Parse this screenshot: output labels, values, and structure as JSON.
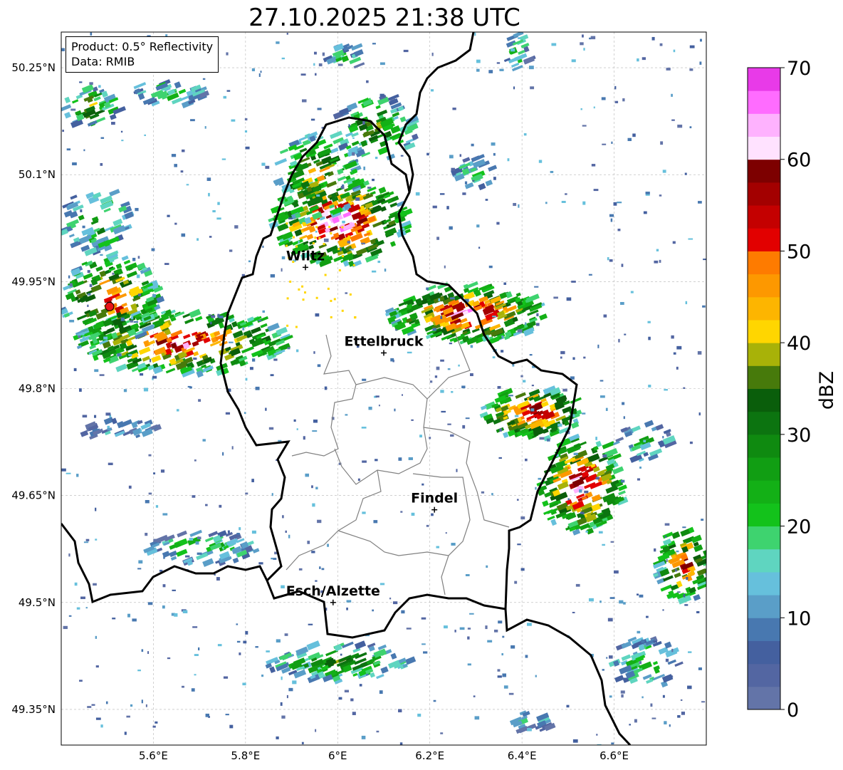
{
  "title": "27.10.2025 21:38 UTC",
  "info": {
    "product": "Product: 0.5° Reflectivity",
    "data": "Data: RMIB"
  },
  "extent": {
    "lon": [
      5.4,
      6.8
    ],
    "lat": [
      49.3,
      50.3
    ]
  },
  "x_ticks": [
    {
      "value": 5.6,
      "label": "5.6°E"
    },
    {
      "value": 5.8,
      "label": "5.8°E"
    },
    {
      "value": 6.0,
      "label": "6°E"
    },
    {
      "value": 6.2,
      "label": "6.2°E"
    },
    {
      "value": 6.4,
      "label": "6.4°E"
    },
    {
      "value": 6.6,
      "label": "6.6°E"
    }
  ],
  "y_ticks": [
    {
      "value": 50.25,
      "label": "50.25°N"
    },
    {
      "value": 50.1,
      "label": "50.1°N"
    },
    {
      "value": 49.95,
      "label": "49.95°N"
    },
    {
      "value": 49.8,
      "label": "49.8°N"
    },
    {
      "value": 49.65,
      "label": "49.65°N"
    },
    {
      "value": 49.5,
      "label": "49.5°N"
    },
    {
      "value": 49.35,
      "label": "49.35°N"
    }
  ],
  "cities": [
    {
      "name": "Wiltz",
      "lon": 5.93,
      "lat": 49.97
    },
    {
      "name": "Ettelbruck",
      "lon": 6.1,
      "lat": 49.85
    },
    {
      "name": "Findel",
      "lon": 6.21,
      "lat": 49.63
    },
    {
      "name": "Esch/Alzette",
      "lon": 5.99,
      "lat": 49.5
    }
  ],
  "radar_site": {
    "lon": 5.505,
    "lat": 49.915,
    "color": "#e8141a"
  },
  "colorbar": {
    "label": "dBZ",
    "min": 0,
    "max": 70,
    "ticks": [
      {
        "value": 0,
        "label": "0"
      },
      {
        "value": 10,
        "label": "10"
      },
      {
        "value": 20,
        "label": "20"
      },
      {
        "value": 30,
        "label": "30"
      },
      {
        "value": 40,
        "label": "40"
      },
      {
        "value": 50,
        "label": "50"
      },
      {
        "value": 60,
        "label": "60"
      },
      {
        "value": 70,
        "label": "70"
      }
    ],
    "colors": [
      "#6374a8",
      "#5366a2",
      "#44609f",
      "#4878b0",
      "#5a9ec8",
      "#66c0dc",
      "#5fd5c0",
      "#3ed36f",
      "#13c21b",
      "#13b016",
      "#119e13",
      "#0f8a10",
      "#0c7410",
      "#0a5e0b",
      "#477a0b",
      "#a8b208",
      "#ffd600",
      "#fdb500",
      "#fd9800",
      "#fe7b00",
      "#e20000",
      "#c40000",
      "#a30000",
      "#7d0000",
      "#ffe2ff",
      "#feb2fe",
      "#ff6cff",
      "#e83ae8"
    ]
  }
}
